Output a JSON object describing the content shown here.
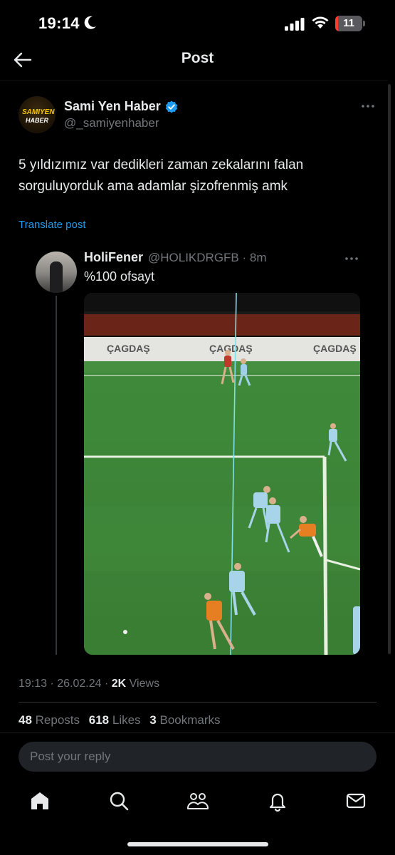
{
  "status_bar": {
    "time": "19:14",
    "battery": "11",
    "battery_level": 0.11,
    "battery_color": "#ff3b30"
  },
  "header": {
    "title": "Post"
  },
  "post": {
    "author_name": "Sami Yen Haber",
    "author_handle": "@_samiyenhaber",
    "avatar_logo_top": "SAMIYEN",
    "avatar_logo_bottom": "HABER",
    "text": "5 yıldızımız var dedikleri zaman zekalarını falan sorguluyorduk ama adamlar şizofrenmiş amk",
    "translate_label": "Translate post",
    "time": "19:13",
    "date": "26.02.24",
    "views_count": "2K",
    "views_label": "Views",
    "reposts_count": "48",
    "reposts_label": "Reposts",
    "likes_count": "618",
    "likes_label": "Likes",
    "bookmarks_count": "3",
    "bookmarks_label": "Bookmarks"
  },
  "quote": {
    "name": "HoliFener",
    "handle_time": "@HOLIKDRGFB · 8m",
    "text": "%100 ofsayt",
    "board_text": "ÇAGDAŞ"
  },
  "reply": {
    "placeholder": "Post your reply"
  },
  "nav": [
    "home-icon",
    "search-icon",
    "communities-icon",
    "notifications-icon",
    "messages-icon"
  ],
  "colors": {
    "accent": "#1d9bf0",
    "background": "#000000",
    "muted": "#71767b"
  }
}
